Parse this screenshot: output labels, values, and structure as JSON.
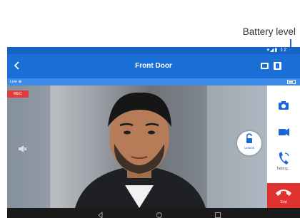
{
  "callout": {
    "label": "Battery level"
  },
  "statusbar": {
    "icons": "▾◢▮ 12"
  },
  "appbar": {
    "title": "Front Door",
    "back_icon": "back-arrow-icon",
    "icons": [
      "snapshot-icon",
      "recordings-icon"
    ]
  },
  "subbar": {
    "live_label": "Live ⊕",
    "battery_icon": "battery-icon",
    "battery_level": 0.75
  },
  "video": {
    "rec_label": "REC",
    "mute_icon": "speaker-mute-icon",
    "unlock_label": "Unlock"
  },
  "rightbar": {
    "buttons": [
      {
        "icon": "camera-icon"
      },
      {
        "icon": "video-record-icon"
      },
      {
        "icon": "phone-talk-icon",
        "label": "Talking..."
      },
      {
        "icon": "hang-up-icon",
        "label": "End"
      }
    ]
  },
  "navbar": {
    "icons": [
      "nav-back-icon",
      "nav-home-icon",
      "nav-recents-icon"
    ]
  },
  "colors": {
    "accent": "#1a66d8",
    "appbar": "#1a6fd6",
    "end": "#e0322f",
    "rec": "#e23c3c"
  }
}
